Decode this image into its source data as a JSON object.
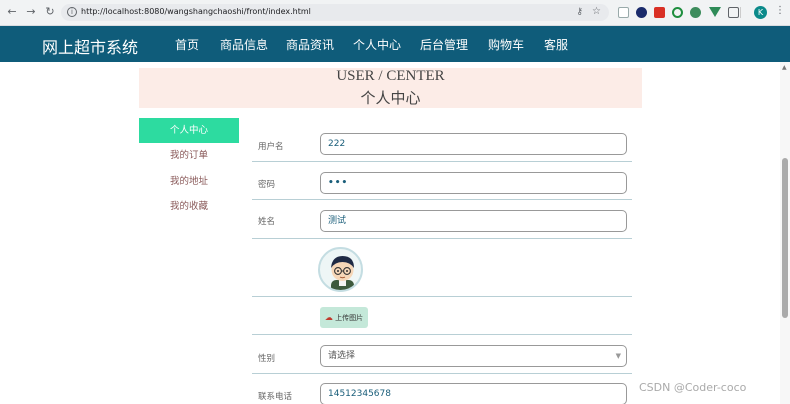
{
  "browser": {
    "url": "http://localhost:8080/wangshangchaoshi/front/index.html",
    "profile_initial": "K"
  },
  "header": {
    "title": "网上超市系统",
    "nav": [
      "首页",
      "商品信息",
      "商品资讯",
      "个人中心",
      "后台管理",
      "购物车",
      "客服"
    ]
  },
  "banner": {
    "en": "USER / CENTER",
    "cn": "个人中心"
  },
  "sidebar": {
    "items": [
      "个人中心",
      "我的订单",
      "我的地址",
      "我的收藏"
    ]
  },
  "form": {
    "username_label": "用户名",
    "username_value": "222",
    "password_label": "密码",
    "password_value": "•••",
    "name_label": "姓名",
    "name_value": "测试",
    "upload_label": "上传图片",
    "gender_label": "性别",
    "gender_placeholder": "请选择",
    "phone_label": "联系电话",
    "phone_value": "14512345678"
  },
  "watermark": "CSDN @Coder-coco",
  "colors": {
    "header": "#0f5c7a",
    "active_menu": "#2ddba0",
    "banner_bg": "#fcece7"
  }
}
